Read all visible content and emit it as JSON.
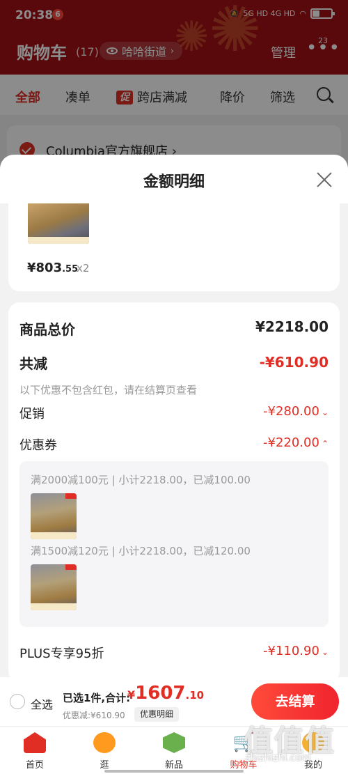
{
  "status_bar": {
    "time": "20:38",
    "app_badge": "6",
    "network": "5G HD 4G HD"
  },
  "header": {
    "title": "购物车",
    "count": "(17)",
    "address": "哈哈街道",
    "manage": "管理",
    "more_badge": "23"
  },
  "filters": {
    "all": "全部",
    "bundle": "凑单",
    "promo_badge": "促",
    "cross_store": "跨店满减",
    "price_drop": "降价",
    "filter": "筛选"
  },
  "store": {
    "name": "Columbia官方旗舰店 ›"
  },
  "sheet": {
    "title": "金额明细",
    "item_price_int": "¥803",
    "item_price_dec": ".55",
    "item_qty": "x2",
    "subtotal_label": "商品总价",
    "subtotal_value": "¥2218.00",
    "total_discount_label": "共减",
    "total_discount_value": "-¥610.90",
    "note": "以下优惠不包含红包，请在结算页查看",
    "promotion_label": "促销",
    "promotion_value": "-¥280.00",
    "coupon_label": "优惠券",
    "coupon_value": "-¥220.00",
    "coupons": [
      {
        "text": "满2000减100元 | 小计2218.00，已减100.00"
      },
      {
        "text": "满1500减120元 | 小计2218.00，已减120.00"
      }
    ],
    "plus_label": "PLUS专享95折",
    "plus_value": "-¥110.90"
  },
  "checkout": {
    "select_all": "全选",
    "selected": "已选1件,合计:",
    "total_yen": "¥",
    "total_int": "1607",
    "total_dec": ".10",
    "discount": "优惠减:¥610.90",
    "detail_chip": "优惠明细",
    "button": "去结算"
  },
  "tabbar": {
    "items": [
      {
        "label": "首页"
      },
      {
        "label": "逛"
      },
      {
        "label": "新品"
      },
      {
        "label": "购物车"
      },
      {
        "label": "我的"
      }
    ]
  },
  "watermark": {
    "text": "值值值",
    "url": "zhizhizhi.com"
  },
  "colors": {
    "header_red": "#a30f14",
    "accent_red": "#e02e24"
  }
}
